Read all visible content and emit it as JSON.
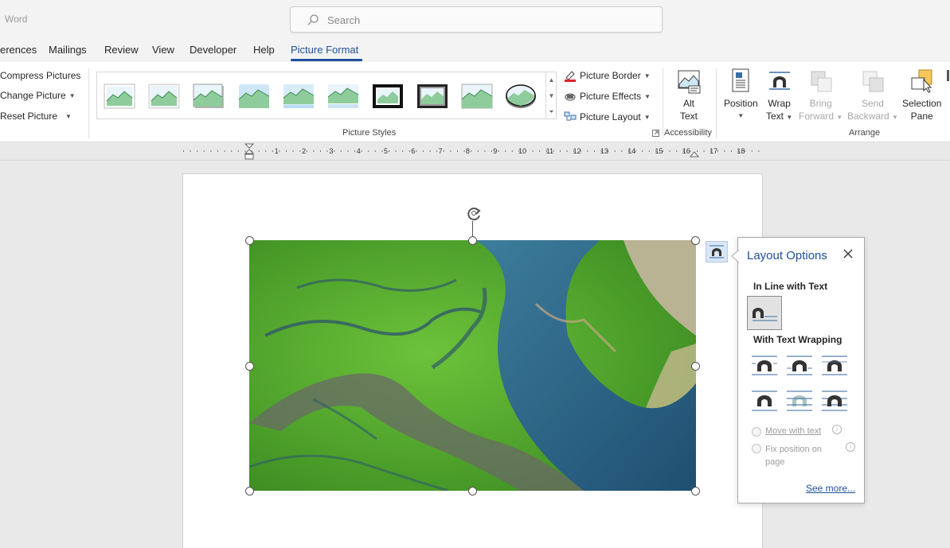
{
  "app": {
    "name": "Word"
  },
  "search": {
    "placeholder": "Search"
  },
  "tabs": [
    {
      "label": "erences"
    },
    {
      "label": "Mailings"
    },
    {
      "label": "Review"
    },
    {
      "label": "View"
    },
    {
      "label": "Developer"
    },
    {
      "label": "Help"
    },
    {
      "label": "Picture Format",
      "active": true
    }
  ],
  "ribbon": {
    "adjust": {
      "compress": "Compress Pictures",
      "change": "Change Picture",
      "reset": "Reset Picture"
    },
    "picture_styles": {
      "label": "Picture Styles",
      "border": "Picture Border",
      "effects": "Picture Effects",
      "layout": "Picture Layout"
    },
    "accessibility": {
      "label": "Accessibility",
      "alt_text_1": "Alt",
      "alt_text_2": "Text"
    },
    "arrange": {
      "label": "Arrange",
      "position": "Position",
      "wrap_1": "Wrap",
      "wrap_2": "Text",
      "bring_1": "Bring",
      "bring_2": "Forward",
      "send_1": "Send",
      "send_2": "Backward",
      "selection_1": "Selection",
      "selection_2": "Pane"
    }
  },
  "ruler": {
    "numbers": [
      "1",
      "2",
      "3",
      "4",
      "5",
      "6",
      "7",
      "8",
      "9",
      "10",
      "11",
      "12",
      "13",
      "14",
      "15",
      "16",
      "17",
      "18"
    ]
  },
  "layout_options": {
    "title": "Layout Options",
    "inline_heading": "In Line with Text",
    "wrapping_heading": "With Text Wrapping",
    "move_with_text": "Move with text",
    "fix_position_1": "Fix position on",
    "fix_position_2": "page",
    "see_more": "See more..."
  },
  "colors": {
    "accent": "#1e4f9c",
    "ribbon_bg": "#ffffff",
    "chrome_bg": "#f3f3f3",
    "canvas_bg": "#e9e9e9"
  }
}
